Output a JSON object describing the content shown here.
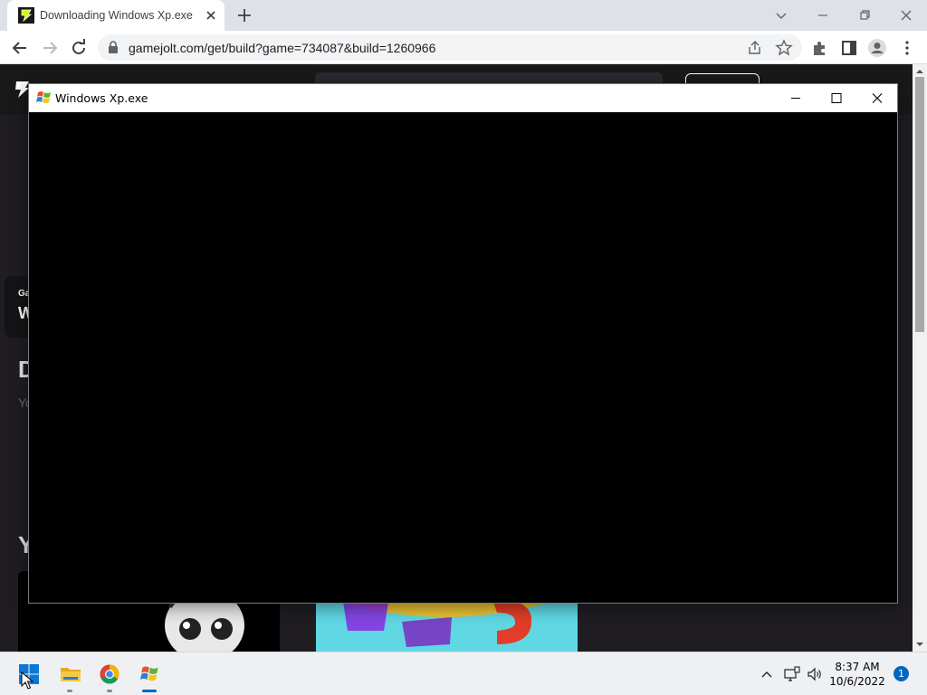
{
  "browser": {
    "tab": {
      "title": "Downloading Windows Xp.exe -"
    },
    "omnibox": {
      "url": "gamejolt.com/get/build?game=734087&build=1260966"
    },
    "colors": {
      "tabstrip": "#dee1e6",
      "toolbar": "#ffffff",
      "omnibox": "#f1f3f4"
    }
  },
  "page": {
    "peek_texts": [
      "Ga",
      "W",
      "D",
      "Yo",
      "Y"
    ],
    "colors": {
      "background": "#1f1d22",
      "header": "#191919",
      "thumbnail_sky": "#60d8e4"
    }
  },
  "app_window": {
    "title": "Windows Xp.exe",
    "content_color": "#000000"
  },
  "taskbar": {
    "apps": [
      {
        "icon": "windows-start-icon",
        "state": "idle"
      },
      {
        "icon": "file-explorer-icon",
        "state": "running"
      },
      {
        "icon": "chrome-icon",
        "state": "running"
      },
      {
        "icon": "windows-xp-app-icon",
        "state": "active"
      }
    ],
    "clock": {
      "time": "8:37 AM",
      "date": "10/6/2022"
    },
    "notification_count": "1"
  }
}
